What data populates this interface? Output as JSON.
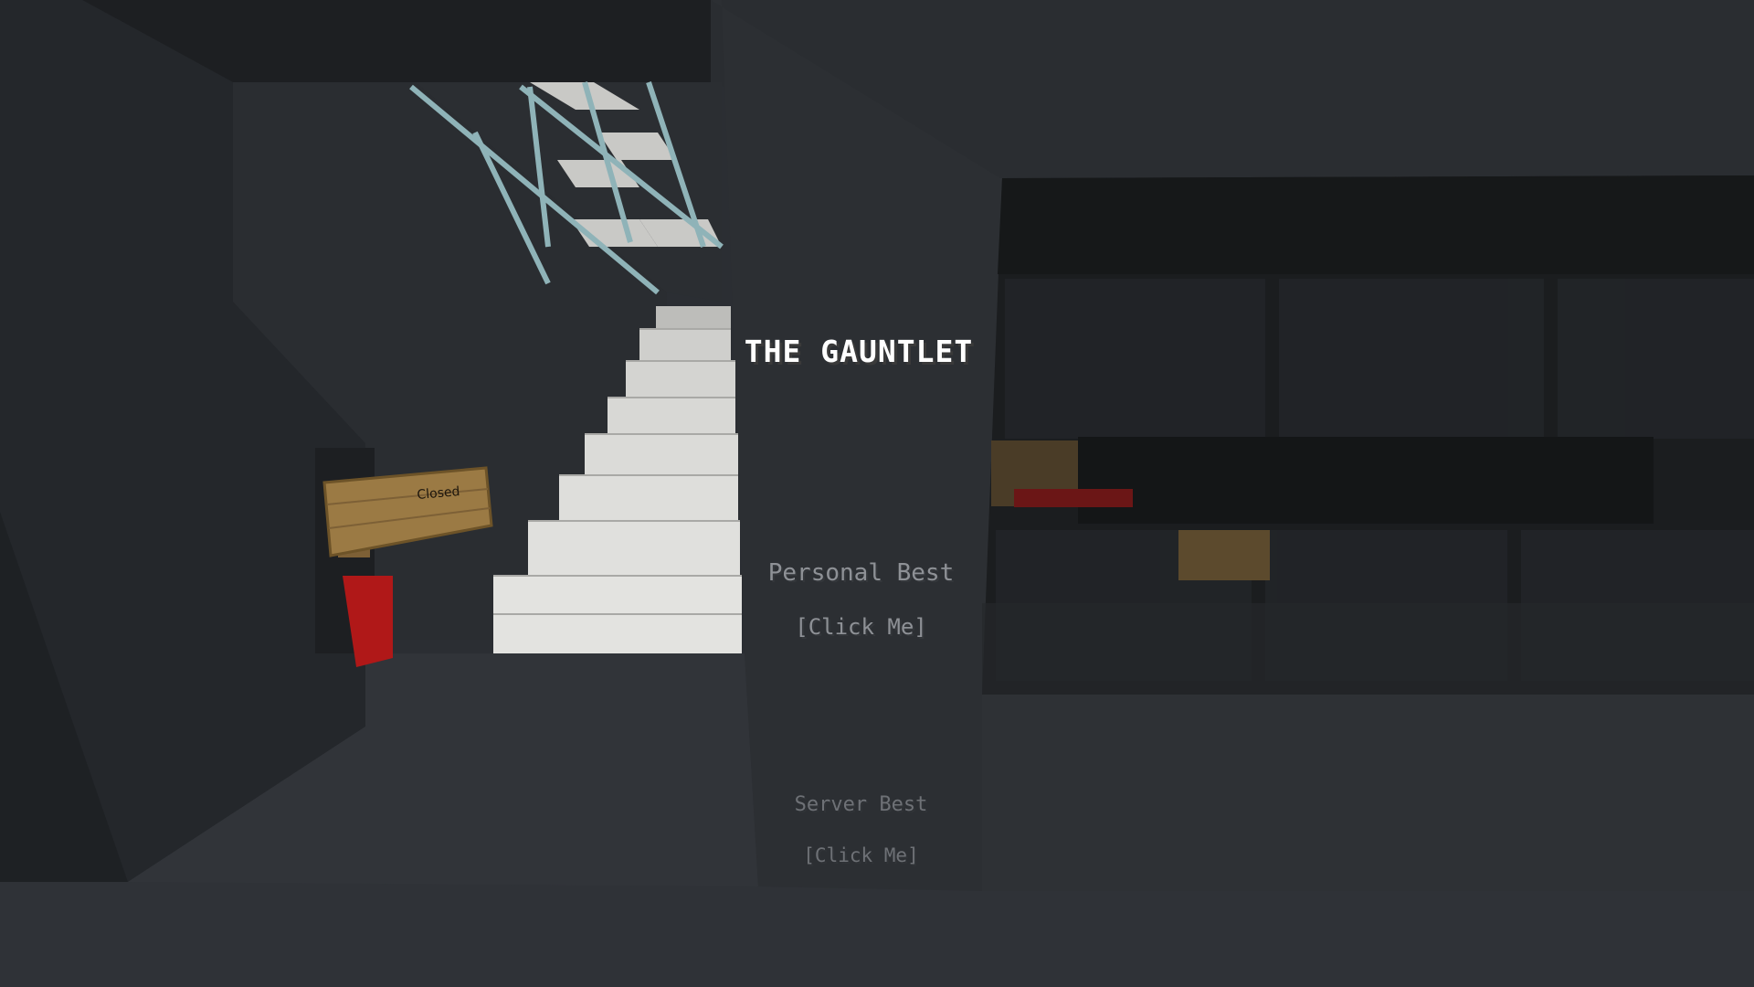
{
  "game": {
    "hud": {
      "title_hologram": "THE GAUNTLET",
      "personal_best": {
        "label": "Personal Best",
        "action": "[Click Me]"
      },
      "server_best": {
        "label": "Server Best",
        "action": "[Click Me]"
      }
    },
    "world": {
      "sign_text": "Closed"
    },
    "colors": {
      "wall_dark": "#26292d",
      "floor": "#2e3136",
      "quartz": "#d6d6d3",
      "glass_pane": "#8fb3b8",
      "sign_wood": "#9b7a44",
      "red_block": "#b01818",
      "title_text": "#ffffff"
    }
  }
}
